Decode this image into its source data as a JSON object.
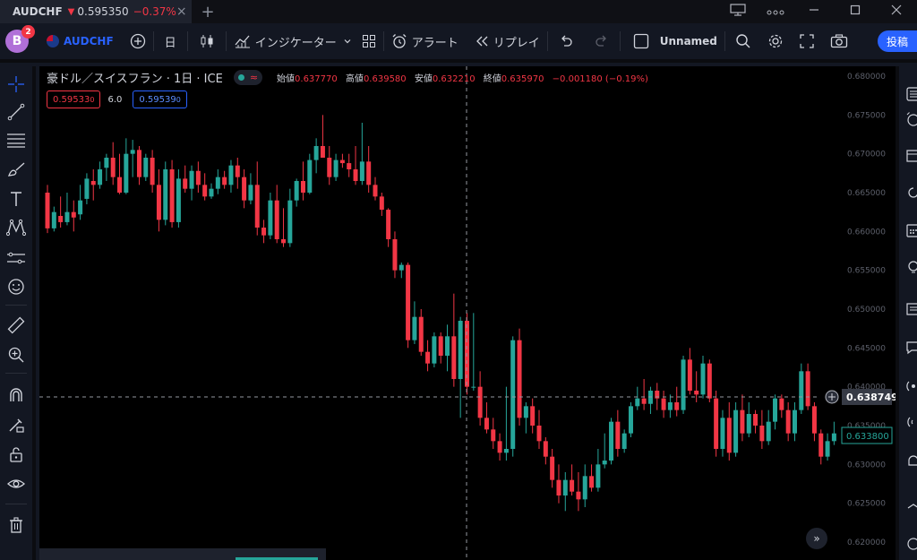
{
  "tab": {
    "symbol": "AUDCHF",
    "arrow": "▼",
    "price": "0.595350",
    "change": "−0.37%"
  },
  "toolbar": {
    "avatar_letter": "B",
    "notifications": "2",
    "symbol": "AUDCHF",
    "interval": "日",
    "indicators": "インジケーター",
    "alert": "アラート",
    "replay": "リプレイ",
    "layout_name": "Unnamed",
    "post": "投稿"
  },
  "legend": {
    "title": "豪ドル／スイスフラン · 1日 · ICE",
    "ohlc": {
      "open_label": "始値",
      "open": "0.637770",
      "high_label": "高値",
      "high": "0.639580",
      "low_label": "安値",
      "low": "0.632210",
      "close_label": "終値",
      "close": "0.635970",
      "change": "−0.001180 (−0.19%)"
    }
  },
  "trade": {
    "sell": "0.59533",
    "sell_suffix": "0",
    "spread": "6.0",
    "buy": "0.59539",
    "buy_suffix": "0"
  },
  "price_axis": {
    "ticks": [
      "0.680000",
      "0.675000",
      "0.670000",
      "0.665000",
      "0.660000",
      "0.655000",
      "0.650000",
      "0.645000",
      "0.640000",
      "0.635000",
      "0.630000",
      "0.625000",
      "0.620000"
    ],
    "crosshair_label": "0.638749",
    "last_price_label": "0.633800"
  },
  "colors": {
    "up": "#26a69a",
    "down": "#f23645",
    "accent": "#2962ff",
    "background": "#000000",
    "panel": "#131722"
  },
  "chart_data": {
    "type": "candlestick",
    "ylim": [
      0.62,
      0.68
    ],
    "candles": [
      [
        0.665,
        0.666,
        0.6598,
        0.6604
      ],
      [
        0.6604,
        0.6632,
        0.66,
        0.6625
      ],
      [
        0.662,
        0.6645,
        0.6605,
        0.6612
      ],
      [
        0.6612,
        0.665,
        0.6608,
        0.6625
      ],
      [
        0.6625,
        0.664,
        0.66,
        0.6618
      ],
      [
        0.6622,
        0.666,
        0.6615,
        0.664
      ],
      [
        0.6642,
        0.6675,
        0.6635,
        0.6668
      ],
      [
        0.6665,
        0.668,
        0.664,
        0.666
      ],
      [
        0.666,
        0.669,
        0.6655,
        0.668
      ],
      [
        0.6682,
        0.67,
        0.6665,
        0.6695
      ],
      [
        0.6695,
        0.6715,
        0.666,
        0.667
      ],
      [
        0.667,
        0.67,
        0.6648,
        0.665
      ],
      [
        0.665,
        0.672,
        0.6648,
        0.67
      ],
      [
        0.67,
        0.6718,
        0.667,
        0.6705
      ],
      [
        0.6705,
        0.671,
        0.666,
        0.667
      ],
      [
        0.667,
        0.67,
        0.6665,
        0.6695
      ],
      [
        0.6695,
        0.6705,
        0.665,
        0.666
      ],
      [
        0.666,
        0.668,
        0.66,
        0.6615
      ],
      [
        0.6615,
        0.669,
        0.6608,
        0.668
      ],
      [
        0.668,
        0.6692,
        0.6605,
        0.6612
      ],
      [
        0.6612,
        0.668,
        0.6605,
        0.6668
      ],
      [
        0.6668,
        0.6685,
        0.665,
        0.6655
      ],
      [
        0.6655,
        0.6685,
        0.664,
        0.6678
      ],
      [
        0.6678,
        0.669,
        0.665,
        0.666
      ],
      [
        0.666,
        0.6675,
        0.664,
        0.6645
      ],
      [
        0.6645,
        0.6662,
        0.6642,
        0.6655
      ],
      [
        0.6655,
        0.668,
        0.6648,
        0.667
      ],
      [
        0.667,
        0.6678,
        0.6655,
        0.666
      ],
      [
        0.666,
        0.6692,
        0.665,
        0.6685
      ],
      [
        0.6685,
        0.6695,
        0.6655,
        0.667
      ],
      [
        0.667,
        0.668,
        0.663,
        0.664
      ],
      [
        0.664,
        0.6675,
        0.6635,
        0.666
      ],
      [
        0.666,
        0.669,
        0.6595,
        0.6605
      ],
      [
        0.6605,
        0.6615,
        0.6585,
        0.6595
      ],
      [
        0.6595,
        0.665,
        0.659,
        0.664
      ],
      [
        0.664,
        0.666,
        0.6585,
        0.659
      ],
      [
        0.659,
        0.663,
        0.658,
        0.6585
      ],
      [
        0.6585,
        0.6655,
        0.658,
        0.664
      ],
      [
        0.664,
        0.6668,
        0.6632,
        0.6665
      ],
      [
        0.6665,
        0.669,
        0.664,
        0.665
      ],
      [
        0.665,
        0.67,
        0.6648,
        0.6692
      ],
      [
        0.6692,
        0.672,
        0.6675,
        0.671
      ],
      [
        0.671,
        0.675,
        0.6695,
        0.6695
      ],
      [
        0.6695,
        0.671,
        0.666,
        0.667
      ],
      [
        0.667,
        0.67,
        0.6665,
        0.6692
      ],
      [
        0.6692,
        0.67,
        0.6682,
        0.6688
      ],
      [
        0.6688,
        0.67,
        0.667,
        0.668
      ],
      [
        0.668,
        0.671,
        0.666,
        0.6665
      ],
      [
        0.6665,
        0.674,
        0.666,
        0.669
      ],
      [
        0.669,
        0.671,
        0.665,
        0.666
      ],
      [
        0.666,
        0.667,
        0.664,
        0.6645
      ],
      [
        0.6645,
        0.665,
        0.662,
        0.6628
      ],
      [
        0.6628,
        0.663,
        0.658,
        0.659
      ],
      [
        0.659,
        0.66,
        0.654,
        0.655
      ],
      [
        0.655,
        0.656,
        0.654,
        0.6557
      ],
      [
        0.6557,
        0.656,
        0.645,
        0.646
      ],
      [
        0.646,
        0.651,
        0.6455,
        0.649
      ],
      [
        0.649,
        0.65,
        0.644,
        0.6445
      ],
      [
        0.6445,
        0.646,
        0.642,
        0.643
      ],
      [
        0.643,
        0.647,
        0.6425,
        0.6465
      ],
      [
        0.6465,
        0.647,
        0.643,
        0.644
      ],
      [
        0.644,
        0.648,
        0.642,
        0.6465
      ],
      [
        0.6465,
        0.652,
        0.64,
        0.641
      ],
      [
        0.641,
        0.649,
        0.636,
        0.6485
      ],
      [
        0.6485,
        0.6495,
        0.639,
        0.64
      ],
      [
        0.64,
        0.6495,
        0.6395,
        0.64
      ],
      [
        0.64,
        0.642,
        0.635,
        0.636
      ],
      [
        0.636,
        0.638,
        0.634,
        0.6345
      ],
      [
        0.6345,
        0.636,
        0.632,
        0.633
      ],
      [
        0.633,
        0.634,
        0.6305,
        0.6315
      ],
      [
        0.6315,
        0.64,
        0.6305,
        0.632
      ],
      [
        0.632,
        0.6465,
        0.631,
        0.646
      ],
      [
        0.646,
        0.6475,
        0.635,
        0.636
      ],
      [
        0.636,
        0.638,
        0.634,
        0.6375
      ],
      [
        0.6375,
        0.6385,
        0.634,
        0.635
      ],
      [
        0.635,
        0.637,
        0.632,
        0.633
      ],
      [
        0.633,
        0.6335,
        0.63,
        0.631
      ],
      [
        0.631,
        0.632,
        0.627,
        0.628
      ],
      [
        0.628,
        0.63,
        0.625,
        0.626
      ],
      [
        0.626,
        0.629,
        0.624,
        0.628
      ],
      [
        0.628,
        0.63,
        0.626,
        0.6265
      ],
      [
        0.6265,
        0.629,
        0.624,
        0.6255
      ],
      [
        0.6255,
        0.63,
        0.6245,
        0.6285
      ],
      [
        0.6285,
        0.63,
        0.6265,
        0.627
      ],
      [
        0.627,
        0.632,
        0.6265,
        0.63
      ],
      [
        0.63,
        0.634,
        0.6295,
        0.6305
      ],
      [
        0.6305,
        0.636,
        0.63,
        0.6355
      ],
      [
        0.6355,
        0.637,
        0.631,
        0.632
      ],
      [
        0.632,
        0.6345,
        0.6315,
        0.634
      ],
      [
        0.634,
        0.638,
        0.6335,
        0.6375
      ],
      [
        0.6375,
        0.64,
        0.637,
        0.6385
      ],
      [
        0.6385,
        0.641,
        0.637,
        0.6378
      ],
      [
        0.6378,
        0.64,
        0.6365,
        0.6395
      ],
      [
        0.6395,
        0.6405,
        0.637,
        0.6385
      ],
      [
        0.6385,
        0.6395,
        0.636,
        0.637
      ],
      [
        0.637,
        0.639,
        0.636,
        0.638
      ],
      [
        0.638,
        0.64,
        0.6362,
        0.637
      ],
      [
        0.637,
        0.644,
        0.6365,
        0.6435
      ],
      [
        0.6435,
        0.645,
        0.639,
        0.6395
      ],
      [
        0.6395,
        0.642,
        0.638,
        0.639
      ],
      [
        0.639,
        0.644,
        0.6385,
        0.643
      ],
      [
        0.643,
        0.6435,
        0.638,
        0.6385
      ],
      [
        0.6385,
        0.6395,
        0.631,
        0.632
      ],
      [
        0.632,
        0.637,
        0.631,
        0.636
      ],
      [
        0.636,
        0.638,
        0.6305,
        0.6315
      ],
      [
        0.6315,
        0.638,
        0.631,
        0.637
      ],
      [
        0.637,
        0.639,
        0.633,
        0.634
      ],
      [
        0.634,
        0.638,
        0.6335,
        0.6365
      ],
      [
        0.6365,
        0.637,
        0.634,
        0.635
      ],
      [
        0.635,
        0.637,
        0.632,
        0.633
      ],
      [
        0.633,
        0.637,
        0.6325,
        0.6355
      ],
      [
        0.6355,
        0.639,
        0.6345,
        0.6385
      ],
      [
        0.6385,
        0.639,
        0.636,
        0.637
      ],
      [
        0.637,
        0.638,
        0.633,
        0.634
      ],
      [
        0.634,
        0.638,
        0.633,
        0.637
      ],
      [
        0.637,
        0.643,
        0.6365,
        0.642
      ],
      [
        0.642,
        0.643,
        0.637,
        0.6375
      ],
      [
        0.6375,
        0.638,
        0.633,
        0.634
      ],
      [
        0.634,
        0.6345,
        0.63,
        0.631
      ],
      [
        0.631,
        0.634,
        0.6305,
        0.633
      ],
      [
        0.633,
        0.6355,
        0.6325,
        0.634
      ]
    ]
  }
}
